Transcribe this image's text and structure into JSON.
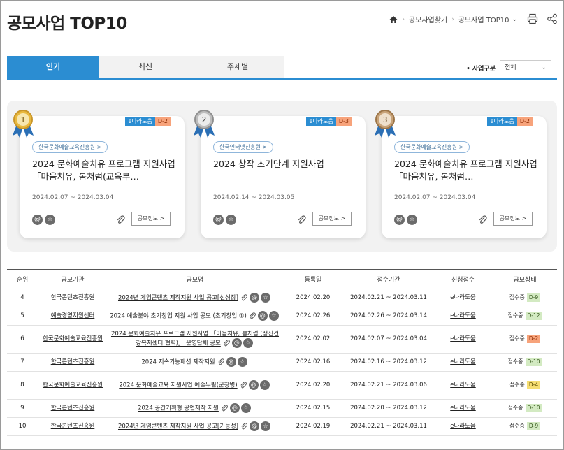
{
  "page": {
    "title": "공모사업 TOP10"
  },
  "breadcrumb": {
    "items": [
      "공모사업찾기",
      "공모사업 TOP10"
    ]
  },
  "tabs": [
    {
      "label": "인기",
      "active": true
    },
    {
      "label": "최신"
    },
    {
      "label": "주제별"
    }
  ],
  "filter": {
    "label": "사업구분",
    "selected": "전체"
  },
  "colors": {
    "accent": "#2b8dd2",
    "d_orange": "#f7a37b",
    "d_yellow": "#f6de73",
    "d_green": "#d3eac2"
  },
  "icons": {
    "home": "home-icon",
    "print": "print-icon",
    "share": "share-icon",
    "attachment": "paperclip-icon",
    "at": "at-icon",
    "star": "star-icon"
  },
  "top_cards": [
    {
      "rank": "1",
      "site": "e나라도움",
      "dday": "D-2",
      "org": "한국문화예술교육진흥원 >",
      "title": "2024 문화예술치유 프로그램 지원사업 「마음치유, 봄처럼(교육부…",
      "dates": "2024.02.07 ~ 2024.03.04",
      "info": "공모정보 >"
    },
    {
      "rank": "2",
      "site": "e나라도움",
      "dday": "D-3",
      "org": "한국인터넷진흥원 >",
      "title": "2024 창작 초기단계 지원사업",
      "dates": "2024.02.14 ~ 2024.03.05",
      "info": "공모정보 >"
    },
    {
      "rank": "3",
      "site": "e나라도움",
      "dday": "D-2",
      "org": "한국문화예술교육진흥원 >",
      "title": "2024 문화예술치유 프로그램 지원사업 「마음치유, 봄처럼…",
      "dates": "2024.02.07 ~ 2024.03.04",
      "info": "공모정보 >"
    }
  ],
  "table": {
    "headers": [
      "순위",
      "공모기관",
      "공모명",
      "등록일",
      "접수기간",
      "신청접수",
      "공모상태"
    ],
    "rows": [
      {
        "rank": "4",
        "org": "한국콘텐츠진흥원",
        "name": "2024년 게임콘텐츠 제작지원 사업 공고[신성장]",
        "reg": "2024.02.20",
        "period": "2024.02.21 ~ 2024.03.11",
        "apply": "e나라도움",
        "status": "접수중",
        "dday": "D-9",
        "dcolor": "green"
      },
      {
        "rank": "5",
        "org": "예술경영지원센터",
        "name": "2024 예술분야 초기창업 지원 사업 공모 (초기창업 ①)",
        "reg": "2024.02.26",
        "period": "2024.02.26 ~ 2024.03.14",
        "apply": "e나라도움",
        "status": "접수중",
        "dday": "D-12",
        "dcolor": "green"
      },
      {
        "rank": "6",
        "org": "한국문화예술교육진흥원",
        "name": "2024 문화예술치유 프로그램 지원사업 「마음치유, 봄처럼 (정신건강복지센터 협력)」 운영단체 공모",
        "reg": "2024.02.02",
        "period": "2024.02.07 ~ 2024.03.04",
        "apply": "e나라도움",
        "status": "접수중",
        "dday": "D-2",
        "dcolor": "orange"
      },
      {
        "rank": "7",
        "org": "한국콘텐츠진흥원",
        "name": "2024 지속가능패션 제작지원",
        "reg": "2024.02.16",
        "period": "2024.02.16 ~ 2024.03.12",
        "apply": "e나라도움",
        "status": "접수중",
        "dday": "D-10",
        "dcolor": "green"
      },
      {
        "rank": "8",
        "org": "한국문화예술교육진흥원",
        "name": "2024 문화예술교육 지원사업 예술누림(군장병)",
        "reg": "2024.02.20",
        "period": "2024.02.21 ~ 2024.03.06",
        "apply": "e나라도움",
        "status": "접수중",
        "dday": "D-4",
        "dcolor": "yellow"
      },
      {
        "rank": "9",
        "org": "한국콘텐츠진흥원",
        "name": "2024 공간기획형 공연제작 지원",
        "reg": "2024.02.15",
        "period": "2024.02.20 ~ 2024.03.12",
        "apply": "e나라도움",
        "status": "접수중",
        "dday": "D-10",
        "dcolor": "green"
      },
      {
        "rank": "10",
        "org": "한국콘텐츠진흥원",
        "name": "2024년 게임콘텐츠 제작지원 사업 공고[기능성]",
        "reg": "2024.02.19",
        "period": "2024.02.21 ~ 2024.03.11",
        "apply": "e나라도움",
        "status": "접수중",
        "dday": "D-9",
        "dcolor": "green"
      }
    ]
  }
}
